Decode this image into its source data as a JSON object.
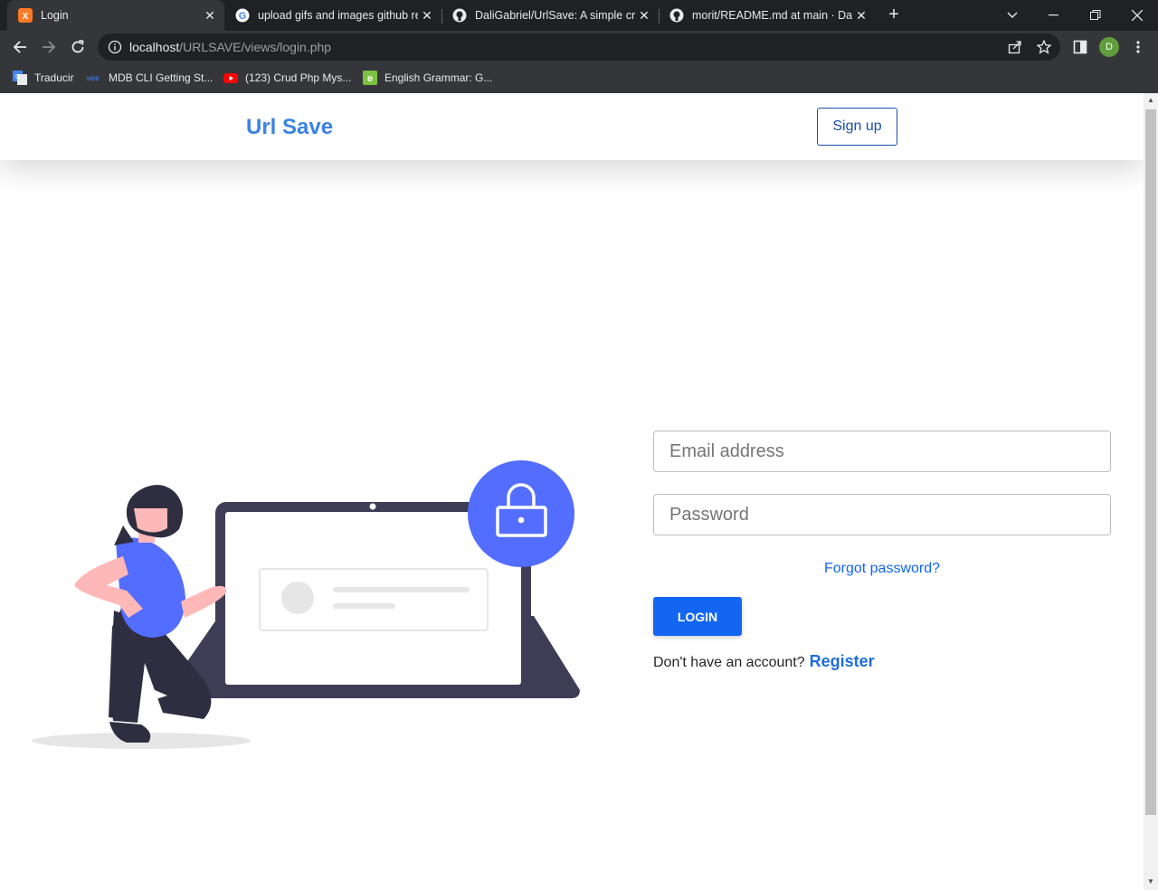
{
  "browser": {
    "tabs": [
      {
        "title": "Login",
        "active": true,
        "favicon": "xampp-icon"
      },
      {
        "title": "upload gifs and images github re",
        "active": false,
        "favicon": "google-icon"
      },
      {
        "title": "DaliGabriel/UrlSave: A simple cru",
        "active": false,
        "favicon": "github-icon"
      },
      {
        "title": "morit/README.md at main · Dali",
        "active": false,
        "favicon": "github-icon"
      }
    ],
    "url_host": "localhost",
    "url_path": "/URLSAVE/views/login.php",
    "profile_initial": "D",
    "bookmarks": [
      {
        "label": "Traducir",
        "icon": "translate-icon"
      },
      {
        "label": "MDB CLI Getting St...",
        "icon": "mdb-icon"
      },
      {
        "label": "(123) Crud Php Mys...",
        "icon": "youtube-icon"
      },
      {
        "label": "English Grammar: G...",
        "icon": "grammar-icon"
      }
    ]
  },
  "site": {
    "brand": "Url Save",
    "signup_label": "Sign up"
  },
  "form": {
    "email_placeholder": "Email address",
    "password_placeholder": "Password",
    "forgot_label": "Forgot password?",
    "login_label": "LOGIN",
    "register_prompt": "Don't have an account?",
    "register_label": "Register"
  },
  "colors": {
    "brand": "#3b82e6",
    "primary": "#1266f1",
    "illustration_accent": "#536dfe",
    "illustration_dark": "#3f3d56"
  }
}
